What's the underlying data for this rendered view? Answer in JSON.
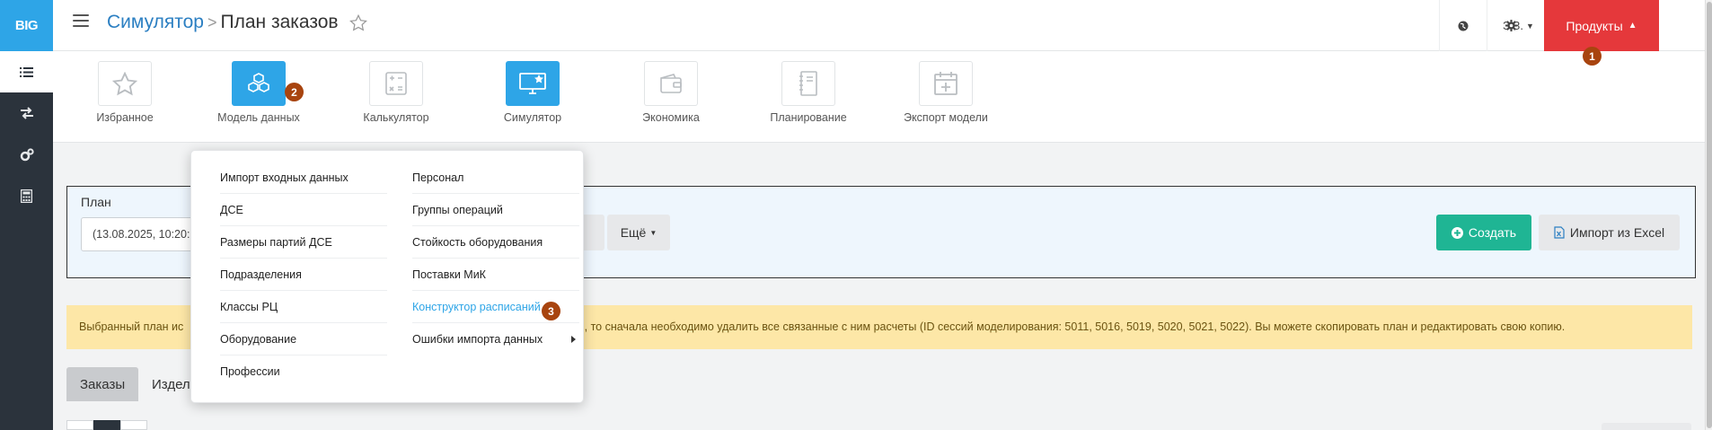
{
  "sidebar": {
    "logo": "BIG",
    "items": [
      {
        "icon": "list-icon",
        "active": true
      },
      {
        "icon": "swap-arrows-icon",
        "active": false
      },
      {
        "icon": "cogs-icon",
        "active": false
      },
      {
        "icon": "calculator-icon",
        "active": false
      }
    ]
  },
  "header": {
    "breadcrumb_parent": "Симулятор",
    "breadcrumb_separator": ">",
    "breadcrumb_current": "План заказов",
    "user_label": "З З.",
    "products_label": "Продукты"
  },
  "tiles": [
    {
      "label": "Избранное",
      "icon": "star-icon",
      "active": false
    },
    {
      "label": "Модель данных",
      "icon": "cubes-icon",
      "active": true
    },
    {
      "label": "Калькулятор",
      "icon": "calculator-icon",
      "active": false
    },
    {
      "label": "Симулятор",
      "icon": "monitor-icon",
      "active": true
    },
    {
      "label": "Экономика",
      "icon": "wallet-icon",
      "active": false
    },
    {
      "label": "Планирование",
      "icon": "notebook-icon",
      "active": false
    },
    {
      "label": "Экспорт модели",
      "icon": "calendar-plus-icon",
      "active": false
    }
  ],
  "badges": {
    "b1": "1",
    "b2": "2",
    "b3": "3"
  },
  "plan": {
    "label": "План",
    "selected_value": "(13.08.2025, 10:20:1",
    "more_label": "Ещё",
    "create_label": "Создать",
    "import_label": "Импорт из Excel"
  },
  "warning": {
    "left_text": "Выбранный план ис",
    "right_text": "тот план, то сначала необходимо удалить все связанные с ним расчеты (ID сессий моделирования: 5011, 5016, 5019, 5020, 5021, 5022). Вы можете скопировать план и редактировать свою копию."
  },
  "tabs": [
    "Заказы",
    "Издел"
  ],
  "dropdown": {
    "left": [
      "Импорт входных данных",
      "ДСЕ",
      "Размеры партий ДСЕ",
      "Подразделения",
      "Классы РЦ",
      "Оборудование",
      "Профессии"
    ],
    "right": [
      "Персонал",
      "Группы операций",
      "Стойкость оборудования",
      "Поставки МиК",
      "Конструктор расписаний",
      "Ошибки импорта данных"
    ]
  },
  "colors": {
    "brand_blue": "#2ea5e7",
    "sidebar_dark": "#2b333c",
    "products_red": "#e5383b",
    "create_green": "#1fb594",
    "badge_brown": "#a8440f",
    "warning_bg": "#fde7a7"
  }
}
